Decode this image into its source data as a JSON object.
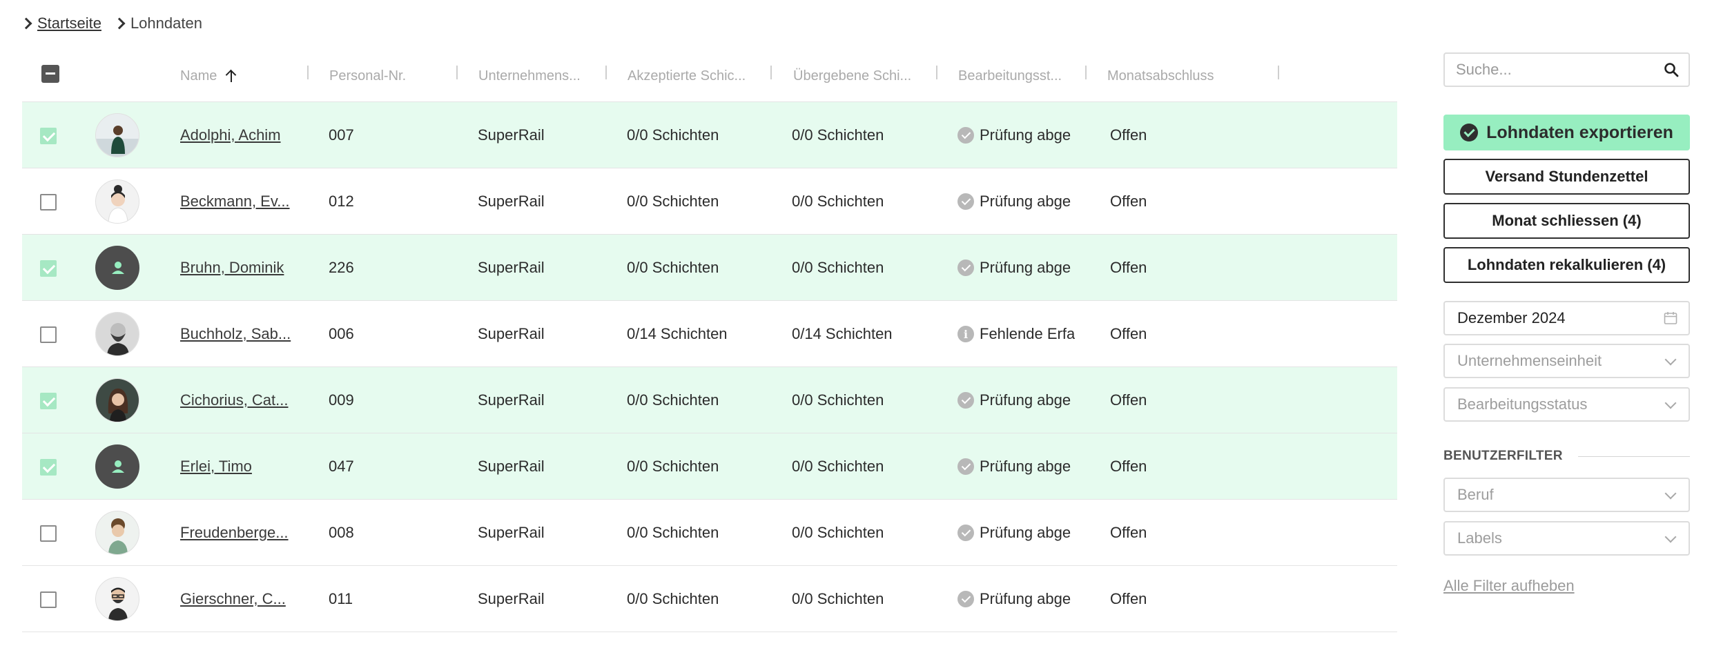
{
  "breadcrumb": {
    "home": "Startseite",
    "current": "Lohndaten"
  },
  "table": {
    "columns": [
      "Name",
      "Personal-Nr.",
      "Unternehmens...",
      "Akzeptierte Schic...",
      "Übergebene Schi...",
      "Bearbeitungsst...",
      "Monatsabschluss"
    ],
    "rows": [
      {
        "selected": true,
        "avatar": "photo-man-outdoor",
        "name": "Adolphi, Achim",
        "nr": "007",
        "unit": "SuperRail",
        "accepted": "0/0 Schichten",
        "handed": "0/0 Schichten",
        "status_icon": "check",
        "status": "Prüfung abge",
        "month": "Offen"
      },
      {
        "selected": false,
        "avatar": "photo-woman-bun",
        "name": "Beckmann, Ev...",
        "nr": "012",
        "unit": "SuperRail",
        "accepted": "0/0 Schichten",
        "handed": "0/0 Schichten",
        "status_icon": "check",
        "status": "Prüfung abge",
        "month": "Offen"
      },
      {
        "selected": true,
        "avatar": "placeholder",
        "name": "Bruhn, Dominik",
        "nr": "226",
        "unit": "SuperRail",
        "accepted": "0/0 Schichten",
        "handed": "0/0 Schichten",
        "status_icon": "check",
        "status": "Prüfung abge",
        "month": "Offen"
      },
      {
        "selected": false,
        "avatar": "photo-bearded-man",
        "name": "Buchholz, Sab...",
        "nr": "006",
        "unit": "SuperRail",
        "accepted": "0/14 Schichten",
        "handed": "0/14 Schichten",
        "status_icon": "info",
        "status": "Fehlende Erfa",
        "month": "Offen"
      },
      {
        "selected": true,
        "avatar": "photo-woman-dark",
        "name": "Cichorius, Cat...",
        "nr": "009",
        "unit": "SuperRail",
        "accepted": "0/0 Schichten",
        "handed": "0/0 Schichten",
        "status_icon": "check",
        "status": "Prüfung abge",
        "month": "Offen"
      },
      {
        "selected": true,
        "avatar": "placeholder",
        "name": "Erlei, Timo",
        "nr": "047",
        "unit": "SuperRail",
        "accepted": "0/0 Schichten",
        "handed": "0/0 Schichten",
        "status_icon": "check",
        "status": "Prüfung abge",
        "month": "Offen"
      },
      {
        "selected": false,
        "avatar": "photo-curly-man",
        "name": "Freudenberge...",
        "nr": "008",
        "unit": "SuperRail",
        "accepted": "0/0 Schichten",
        "handed": "0/0 Schichten",
        "status_icon": "check",
        "status": "Prüfung abge",
        "month": "Offen"
      },
      {
        "selected": false,
        "avatar": "photo-man-glasses",
        "name": "Gierschner, C...",
        "nr": "011",
        "unit": "SuperRail",
        "accepted": "0/0 Schichten",
        "handed": "0/0 Schichten",
        "status_icon": "check",
        "status": "Prüfung abge",
        "month": "Offen"
      }
    ]
  },
  "sidebar": {
    "search_placeholder": "Suche...",
    "export_label": "Lohndaten exportieren",
    "send_label": "Versand Stundenzettel",
    "close_month_label": "Monat schliessen (4)",
    "recalc_label": "Lohndaten rekalkulieren (4)",
    "month_value": "Dezember 2024",
    "unit_placeholder": "Unternehmenseinheit",
    "status_placeholder": "Bearbeitungsstatus",
    "user_filter_title": "BENUTZERFILTER",
    "job_placeholder": "Beruf",
    "labels_placeholder": "Labels",
    "clear_filters_label": "Alle Filter aufheben"
  },
  "colors": {
    "selected_row": "#e6fbef",
    "accent": "#97eec0",
    "checkbox_checked": "#a6e8c3"
  }
}
